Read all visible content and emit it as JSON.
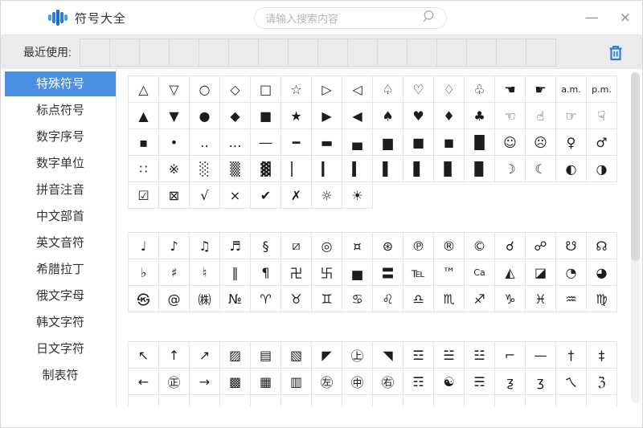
{
  "window": {
    "title": "符号大全",
    "minimize_label": "—",
    "close_label": "×",
    "accent_color": "#2a7de1",
    "selected_color": "#4a90e2"
  },
  "titlebar": {
    "app_logo_icon": "equalizer-bars-icon",
    "search": {
      "placeholder": "请输入搜索内容",
      "value": "",
      "icon": "magnifier-icon"
    }
  },
  "recent": {
    "label": "最近使用:",
    "slot_count": 16,
    "slots_empty": true,
    "clear_icon": "trash-icon"
  },
  "sidebar": {
    "items": [
      {
        "label": "特殊符号",
        "active": true
      },
      {
        "label": "标点符号",
        "active": false
      },
      {
        "label": "数字序号",
        "active": false
      },
      {
        "label": "数字单位",
        "active": false
      },
      {
        "label": "拼音注音",
        "active": false
      },
      {
        "label": "中文部首",
        "active": false
      },
      {
        "label": "英文音符",
        "active": false
      },
      {
        "label": "希腊拉丁",
        "active": false
      },
      {
        "label": "俄文字母",
        "active": false
      },
      {
        "label": "韩文字符",
        "active": false
      },
      {
        "label": "日文字符",
        "active": false
      },
      {
        "label": "制表符",
        "active": false
      }
    ]
  },
  "symbol_panel": {
    "scrollbar": true,
    "blocks": [
      {
        "rows": [
          {
            "cells": [
              "△",
              "▽",
              "○",
              "◇",
              "□",
              "☆",
              "▷",
              "◁",
              "♤",
              "♡",
              "♢",
              "♧",
              "☚",
              "☛",
              "a.m.",
              "p.m."
            ]
          },
          {
            "cells": [
              "▲",
              "▼",
              "●",
              "◆",
              "■",
              "★",
              "▶",
              "◀",
              "♠",
              "♥",
              "♦",
              "♣",
              "☜",
              "☝",
              "☞",
              "☟"
            ]
          },
          {
            "cells": [
              "▪",
              "•",
              "‥",
              "…",
              "―",
              "━",
              "▬",
              "▄",
              "▆",
              "■",
              "◼",
              "█",
              "☺",
              "☹",
              "♀",
              "♂"
            ]
          },
          {
            "cells": [
              "∷",
              "※",
              "░",
              "▒",
              "▓",
              "▏",
              "▎",
              "▍",
              "▌",
              "▋",
              "▊",
              "▉",
              "☽",
              "☾",
              "◐",
              "◑"
            ]
          },
          {
            "cells": [
              "☑",
              "⊠",
              "√",
              "×",
              "✔",
              "✗",
              "☼",
              "☀"
            ]
          }
        ]
      },
      {
        "rows": [
          {
            "cells": [
              "♩",
              "♪",
              "♫",
              "♬",
              "§",
              "⧄",
              "◎",
              "¤",
              "⊛",
              "℗",
              "®",
              "©",
              "☌",
              "☍",
              "☋",
              "☊"
            ]
          },
          {
            "cells": [
              "♭",
              "♯",
              "♮",
              "‖",
              "¶",
              "卍",
              "卐",
              "▅",
              "〓",
              "℡",
              "™",
              "Ca",
              "◭",
              "◪",
              "◔",
              "◕"
            ]
          },
          {
            "cells": [
              "㉿",
              "@",
              "㈱",
              "№",
              "♈",
              "♉",
              "♊",
              "♋",
              "♌",
              "♎",
              "♏",
              "♐",
              "♑",
              "♓",
              "♒",
              "♍"
            ]
          }
        ]
      },
      {
        "rows": [
          {
            "cells": [
              "↖",
              "↑",
              "↗",
              "▨",
              "▤",
              "▧",
              "◤",
              "㊤",
              "◥",
              "☲",
              "☱",
              "☳",
              "⌐",
              "—",
              "†",
              "‡"
            ]
          },
          {
            "cells": [
              "←",
              "㊣",
              "→",
              "▩",
              "▦",
              "▥",
              "㊧",
              "㊥",
              "㊨",
              "☶",
              "☯",
              "☴",
              "ƺ",
              "ʒ",
              "ㄟ",
              "ℨ"
            ]
          },
          {
            "cells": [],
            "partial": true
          }
        ]
      }
    ]
  }
}
